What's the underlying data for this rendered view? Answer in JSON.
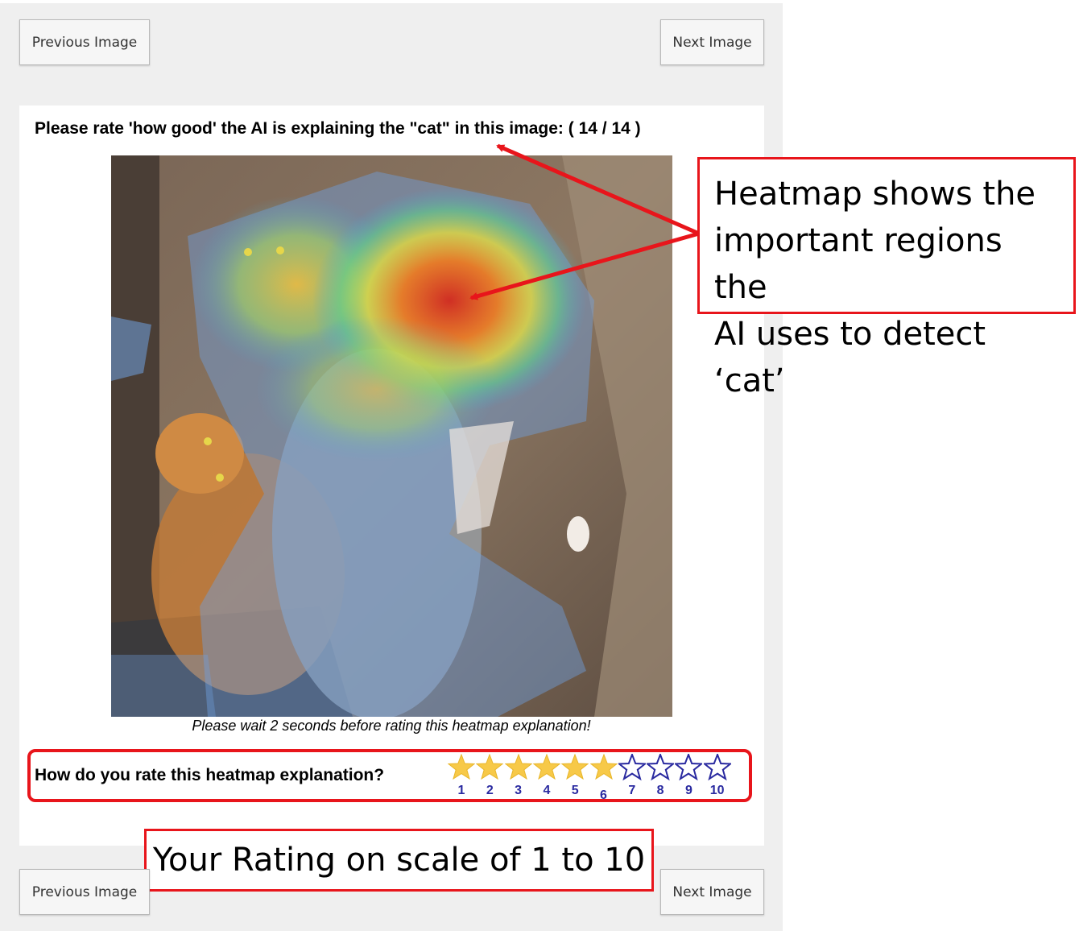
{
  "nav": {
    "previous_label": "Previous Image",
    "next_label": "Next Image"
  },
  "question": "Please rate 'how good' the AI is explaining the \"cat\" in this image: ( 14 / 14 )",
  "wait_note": "Please wait 2 seconds before rating this heatmap explanation!",
  "rating": {
    "label": "How do you rate this heatmap explanation?",
    "stars": [
      "1",
      "2",
      "3",
      "4",
      "5",
      "6",
      "7",
      "8",
      "9",
      "10"
    ],
    "selected": 6,
    "max": 10,
    "filled_color": "#f7c948",
    "empty_color": "#2a2aa0"
  },
  "annotations": {
    "heatmap_callout": [
      "Heatmap shows the",
      "important regions the",
      "AI uses to detect ‘cat’"
    ],
    "rating_callout": "Your Rating on scale of 1 to 10",
    "accent_color": "#e8151b"
  }
}
